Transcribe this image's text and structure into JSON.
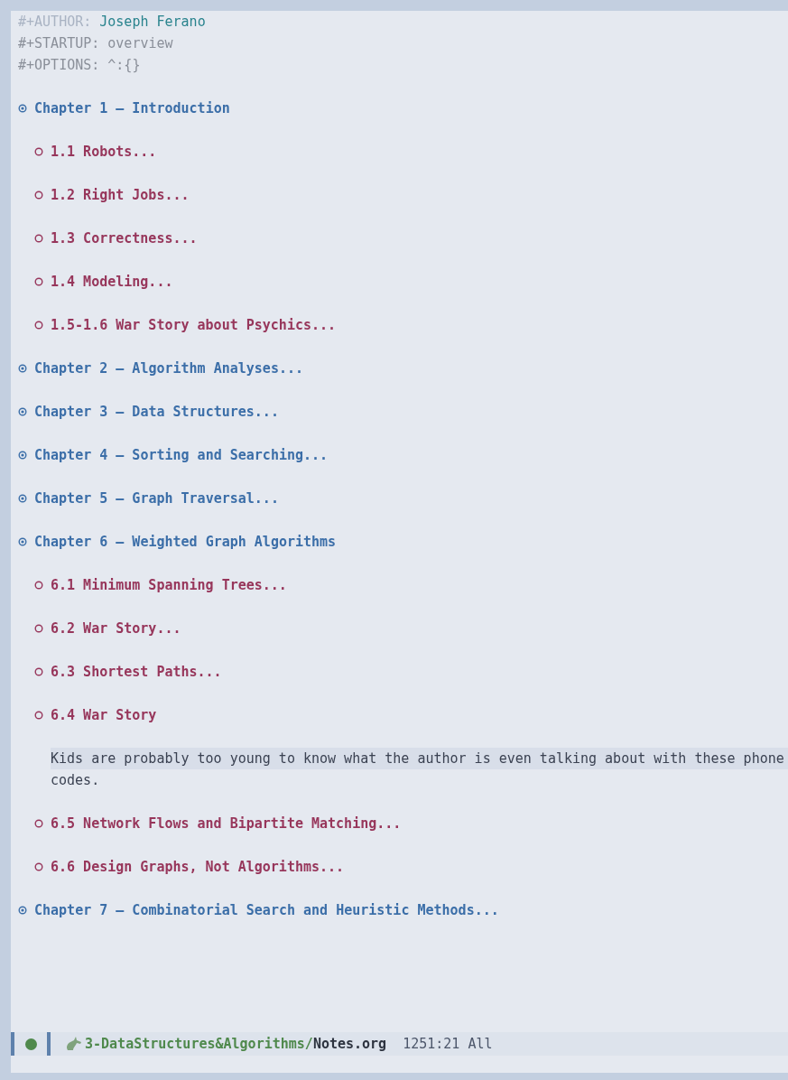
{
  "meta": [
    {
      "kind": "author",
      "key": "#+AUTHOR:",
      "value": "Joseph Ferano"
    },
    {
      "kind": "keyword",
      "key": "#+STARTUP:",
      "value": "overview"
    },
    {
      "kind": "keyword",
      "key": "#+OPTIONS:",
      "value": "^:{}"
    }
  ],
  "outline": [
    {
      "title": "Chapter 1 – Introduction",
      "children": [
        {
          "title": "1.1 Robots..."
        },
        {
          "title": "1.2 Right Jobs..."
        },
        {
          "title": "1.3 Correctness..."
        },
        {
          "title": "1.4 Modeling..."
        },
        {
          "title": "1.5-1.6 War Story about Psychics..."
        }
      ]
    },
    {
      "title": "Chapter 2 – Algorithm Analyses..."
    },
    {
      "title": "Chapter 3 – Data Structures..."
    },
    {
      "title": "Chapter 4 – Sorting and Searching..."
    },
    {
      "title": "Chapter 5 – Graph Traversal..."
    },
    {
      "title": "Chapter 6 – Weighted Graph Algorithms",
      "children": [
        {
          "title": "6.1 Minimum Spanning Trees..."
        },
        {
          "title": "6.2 War Story..."
        },
        {
          "title": "6.3 Shortest Paths..."
        },
        {
          "title": "6.4 War Story",
          "body": {
            "text": "Kids are probably too young to know what the author is even talking about with these phone codes.",
            "current_line": true
          }
        },
        {
          "title": "6.5 Network Flows and Bipartite Matching..."
        },
        {
          "title": "6.6 Design Graphs, Not Algorithms..."
        }
      ]
    },
    {
      "title": "Chapter 7 – Combinatorial Search and Heuristic Methods..."
    }
  ],
  "mode_line": {
    "directory": "3-DataStructures&Algorithms/",
    "file": "Notes.org",
    "position": "1251:21",
    "scroll": "All"
  }
}
